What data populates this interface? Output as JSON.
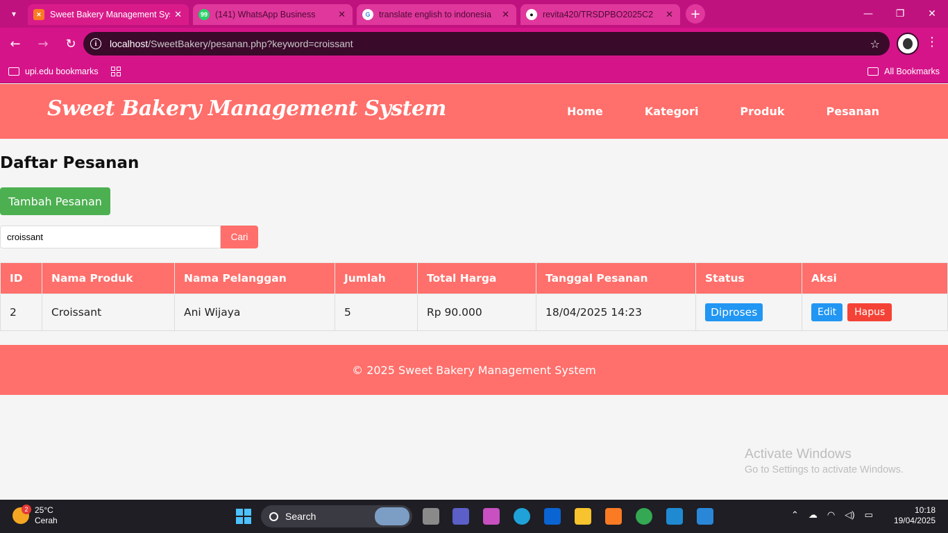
{
  "browser": {
    "tabs": [
      {
        "title": "Sweet Bakery Management Syst",
        "active": true,
        "icon": "xampp-icon"
      },
      {
        "title": "(141) WhatsApp Business",
        "active": false,
        "icon": "whatsapp-icon"
      },
      {
        "title": "translate english to indonesia",
        "active": false,
        "icon": "google-icon"
      },
      {
        "title": "revita420/TRSDPBO2025C2",
        "active": false,
        "icon": "github-icon"
      }
    ],
    "url_host": "localhost",
    "url_path": "/SweetBakery/pesanan.php?keyword=croissant",
    "bookmark_folder": "upi.edu bookmarks",
    "all_bookmarks": "All Bookmarks"
  },
  "site": {
    "brand": "Sweet Bakery Management System",
    "nav": [
      "Home",
      "Kategori",
      "Produk",
      "Pesanan"
    ],
    "page_title": "Daftar Pesanan",
    "add_button": "Tambah Pesanan",
    "search": {
      "value": "croissant",
      "button": "Cari"
    },
    "table": {
      "headers": [
        "ID",
        "Nama Produk",
        "Nama Pelanggan",
        "Jumlah",
        "Total Harga",
        "Tanggal Pesanan",
        "Status",
        "Aksi"
      ],
      "rows": [
        {
          "id": "2",
          "produk": "Croissant",
          "pelanggan": "Ani Wijaya",
          "jumlah": "5",
          "total": "Rp 90.000",
          "tanggal": "18/04/2025 14:23",
          "status": "Diproses",
          "edit": "Edit",
          "hapus": "Hapus"
        }
      ]
    },
    "footer": "© 2025 Sweet Bakery Management System",
    "colors": {
      "primary": "#ff6f6b",
      "add": "#4caf50",
      "info": "#2196f3",
      "danger": "#f44336"
    }
  },
  "watermark": {
    "line1": "Activate Windows",
    "line2": "Go to Settings to activate Windows."
  },
  "taskbar": {
    "temp": "25°C",
    "weather": "Cerah",
    "notif_count": "2",
    "search": "Search",
    "time": "10:18",
    "date": "19/04/2025"
  }
}
